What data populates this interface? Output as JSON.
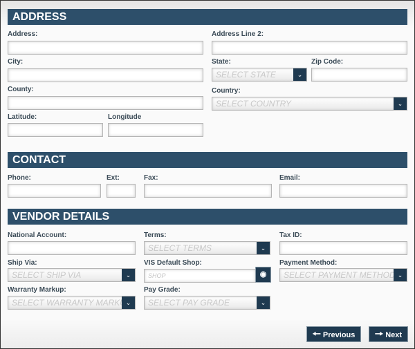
{
  "sections": {
    "address": "ADDRESS",
    "contact": "CONTACT",
    "vendor": "VENDOR DETAILS"
  },
  "address": {
    "address_label": "Address:",
    "address2_label": "Address Line 2:",
    "city_label": "City:",
    "state_label": "State:",
    "state_placeholder": "SELECT STATE",
    "zip_label": "Zip Code:",
    "county_label": "County:",
    "country_label": "Country:",
    "country_placeholder": "SELECT COUNTRY",
    "latitude_label": "Latitude:",
    "longitude_label": "Longitude"
  },
  "contact": {
    "phone_label": "Phone:",
    "ext_label": "Ext:",
    "fax_label": "Fax:",
    "email_label": "Email:"
  },
  "vendor": {
    "national_label": "National Account:",
    "terms_label": "Terms:",
    "terms_placeholder": "SELECT TERMS",
    "taxid_label": "Tax ID:",
    "shipvia_label": "Ship Via:",
    "shipvia_placeholder": "SELECT SHIP VIA",
    "shop_label": "VIS Default Shop:",
    "shop_placeholder": "SHOP",
    "payment_label": "Payment Method:",
    "payment_placeholder": "SELECT PAYMENT METHOD",
    "warranty_label": "Warranty Markup:",
    "warranty_placeholder": "SELECT WARRANTY MARKUP",
    "paygrade_label": "Pay Grade:",
    "paygrade_placeholder": "SELECT PAY GRADE"
  },
  "buttons": {
    "previous": "Previous",
    "next": "Next"
  },
  "icons": {
    "dropdown": "chevron-down-icon",
    "shop_lookup": "binoculars-icon",
    "previous": "arrow-left-icon",
    "next": "arrow-right-icon"
  },
  "colors": {
    "header": "#2d4f6a",
    "button": "#1f3a50"
  }
}
